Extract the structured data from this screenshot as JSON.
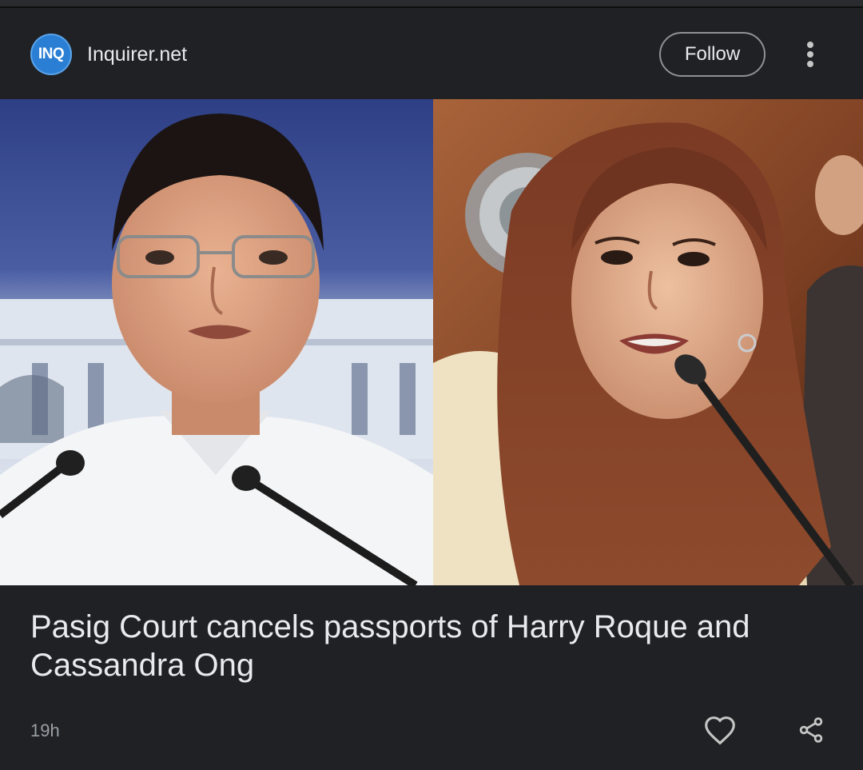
{
  "source": {
    "logo_text": "INQ",
    "name": "Inquirer.net",
    "logo_color": "#2a7fd4"
  },
  "actions": {
    "follow_label": "Follow",
    "more_icon": "more-vert-icon"
  },
  "article": {
    "image_icon": "article-photo",
    "headline": "Pasig Court cancels passports of Harry Roque and Cassandra Ong",
    "time_ago": "19h"
  },
  "footer": {
    "like_icon": "heart-icon",
    "share_icon": "share-icon"
  },
  "colors": {
    "background": "#202124",
    "text_primary": "#e8eaed",
    "text_secondary": "#9aa0a6"
  }
}
